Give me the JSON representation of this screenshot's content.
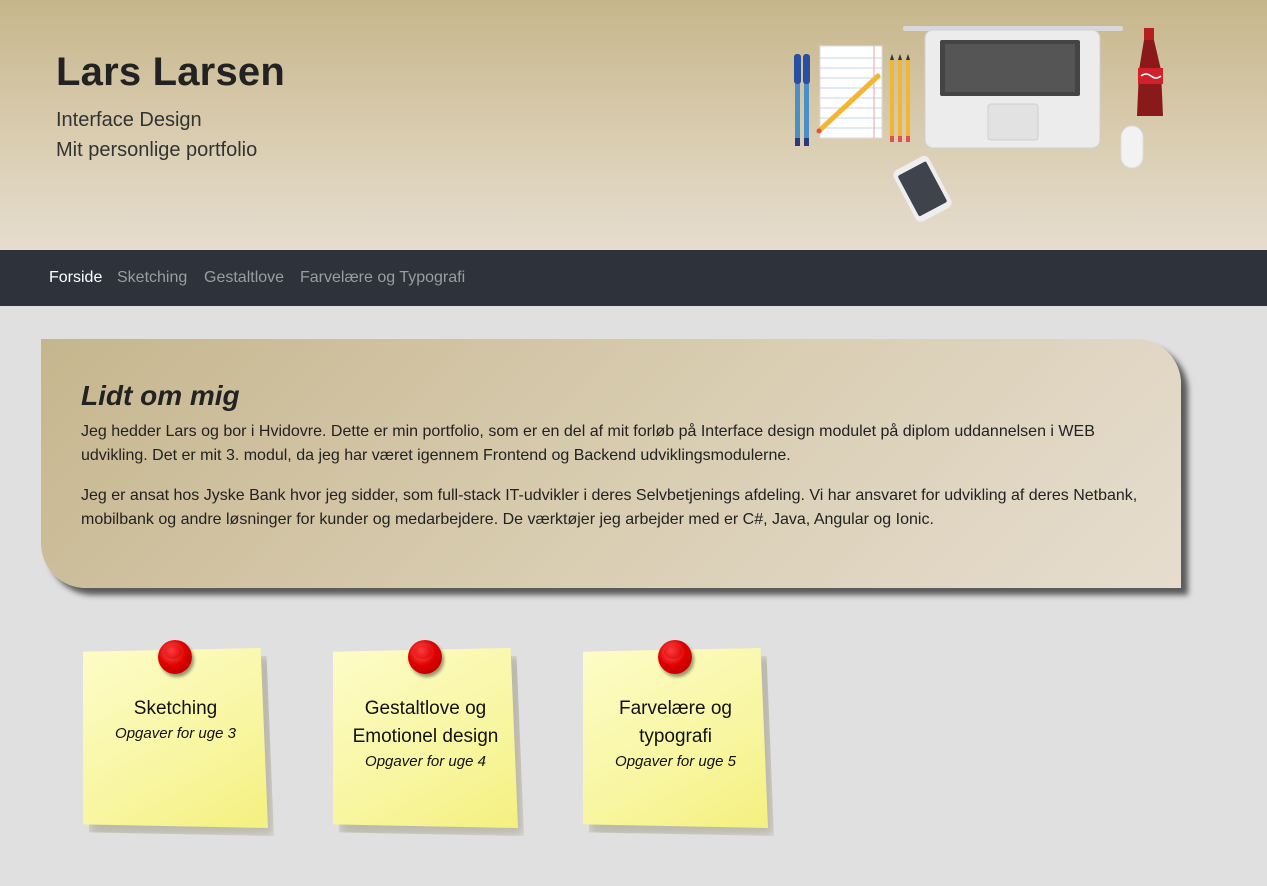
{
  "header": {
    "name": "Lars Larsen",
    "subtitle_1": "Interface Design",
    "subtitle_2": "Mit personlige portfolio"
  },
  "nav": {
    "items": [
      {
        "label": "Forside",
        "active": true
      },
      {
        "label": "Sketching",
        "active": false
      },
      {
        "label": "Gestaltlove",
        "active": false
      },
      {
        "label": "Farvelære og Typografi",
        "active": false
      }
    ]
  },
  "about": {
    "title": "Lidt om mig",
    "paragraph_1": "Jeg hedder Lars og bor i Hvidovre. Dette er min portfolio, som er en del af mit forløb på Interface design modulet på diplom uddannelsen i WEB udvikling. Det er mit 3. modul, da jeg har været igennem Frontend og Backend udviklingsmodulerne.",
    "paragraph_2": "Jeg er ansat hos Jyske Bank hvor jeg sidder, som full-stack IT-udvikler i deres Selvbetjenings afdeling. Vi har ansvaret for udvikling af deres Netbank, mobilbank og andre løsninger for kunder og medarbejdere. De værktøjer jeg arbejder med er C#, Java, Angular og Ionic."
  },
  "notes": [
    {
      "title": "Sketching",
      "week": "Opgaver for uge 3"
    },
    {
      "title": "Gestaltlove og Emotionel design",
      "week": "Opgaver for uge 4"
    },
    {
      "title": "Farvelære og typografi",
      "week": "Opgaver for uge 5"
    }
  ],
  "colors": {
    "header_top": "#c6b68c",
    "header_bottom": "#e6ddcf",
    "nav_background": "#2e323b",
    "nav_active": "#ffffff",
    "nav_inactive": "#9a9ca1",
    "page_background": "#e0e0e0",
    "sticky_note": "#f8f6a0",
    "pin": "#e00000"
  }
}
